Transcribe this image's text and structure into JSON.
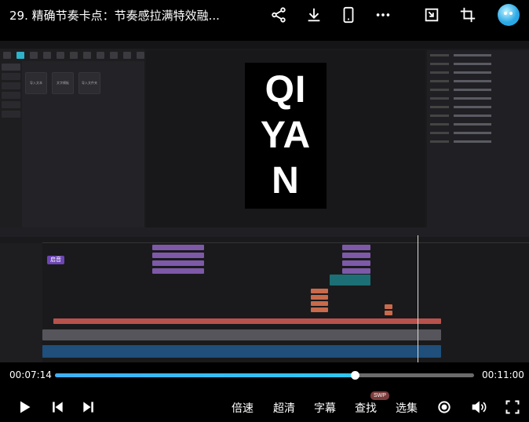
{
  "header": {
    "title": "29. 精确节奏卡点：节奏感拉满特效融...",
    "icons": [
      "share-icon",
      "download-icon",
      "phone-icon",
      "more-icon",
      "pip-icon",
      "crop-icon",
      "avatar"
    ]
  },
  "video": {
    "preview_text": [
      "QI",
      "YA",
      "N"
    ],
    "media_tiles": [
      "导入文本",
      "文字模板",
      "导入文件夹"
    ],
    "tooltip": "启音"
  },
  "progress": {
    "current": "00:07:14",
    "total": "00:11:00",
    "fraction": 0.717
  },
  "controls": {
    "speed": "倍速",
    "quality": "超清",
    "subtitle": "字幕",
    "search": "查找",
    "search_badge": "SWP",
    "episodes": "选集"
  },
  "colors": {
    "accent": "#2ec7f0",
    "clip_purple": "#7d59a8",
    "clip_red": "#b9524c"
  }
}
